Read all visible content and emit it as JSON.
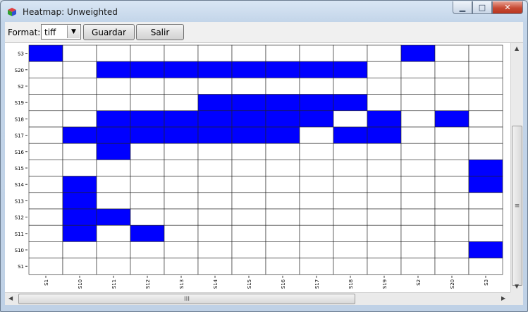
{
  "window": {
    "title": "Heatmap: Unweighted",
    "controls": {
      "minimize": "▁",
      "maximize": "□",
      "close": "✕"
    }
  },
  "toolbar": {
    "format_label": "Format:",
    "format_value": "tiff",
    "save_label": "Guardar",
    "exit_label": "Salir"
  },
  "scrollbar": {
    "grip": "≡",
    "hgrip": "III"
  },
  "colors": {
    "on": "#0000ff",
    "off": "#ffffff",
    "grid": "#222222"
  },
  "chart_data": {
    "type": "heatmap",
    "title": "",
    "columns": [
      "S1",
      "S10",
      "S11",
      "S12",
      "S13",
      "S14",
      "S15",
      "S16",
      "S17",
      "S18",
      "S19",
      "S2",
      "S20",
      "S3"
    ],
    "rows": [
      "S3",
      "S20",
      "S2",
      "S19",
      "S18",
      "S17",
      "S16",
      "S15",
      "S14",
      "S13",
      "S12",
      "S11",
      "S10",
      "S1"
    ],
    "matrix": [
      [
        1,
        0,
        0,
        0,
        0,
        0,
        0,
        0,
        0,
        0,
        0,
        1,
        0,
        0
      ],
      [
        0,
        0,
        1,
        1,
        1,
        1,
        1,
        1,
        1,
        1,
        0,
        0,
        0,
        0
      ],
      [
        0,
        0,
        0,
        0,
        0,
        0,
        0,
        0,
        0,
        0,
        0,
        0,
        0,
        0
      ],
      [
        0,
        0,
        0,
        0,
        0,
        1,
        1,
        1,
        1,
        1,
        0,
        0,
        0,
        0
      ],
      [
        0,
        0,
        1,
        1,
        1,
        1,
        1,
        1,
        1,
        0,
        1,
        0,
        1,
        0
      ],
      [
        0,
        1,
        1,
        1,
        1,
        1,
        1,
        1,
        0,
        1,
        1,
        0,
        0,
        0
      ],
      [
        0,
        0,
        1,
        0,
        0,
        0,
        0,
        0,
        0,
        0,
        0,
        0,
        0,
        0
      ],
      [
        0,
        0,
        0,
        0,
        0,
        0,
        0,
        0,
        0,
        0,
        0,
        0,
        0,
        1
      ],
      [
        0,
        1,
        0,
        0,
        0,
        0,
        0,
        0,
        0,
        0,
        0,
        0,
        0,
        1
      ],
      [
        0,
        1,
        0,
        0,
        0,
        0,
        0,
        0,
        0,
        0,
        0,
        0,
        0,
        0
      ],
      [
        0,
        1,
        1,
        0,
        0,
        0,
        0,
        0,
        0,
        0,
        0,
        0,
        0,
        0
      ],
      [
        0,
        1,
        0,
        1,
        0,
        0,
        0,
        0,
        0,
        0,
        0,
        0,
        0,
        0
      ],
      [
        0,
        0,
        0,
        0,
        0,
        0,
        0,
        0,
        0,
        0,
        0,
        0,
        0,
        1
      ],
      [
        0,
        0,
        0,
        0,
        0,
        0,
        0,
        0,
        0,
        0,
        0,
        0,
        0,
        0
      ]
    ]
  }
}
